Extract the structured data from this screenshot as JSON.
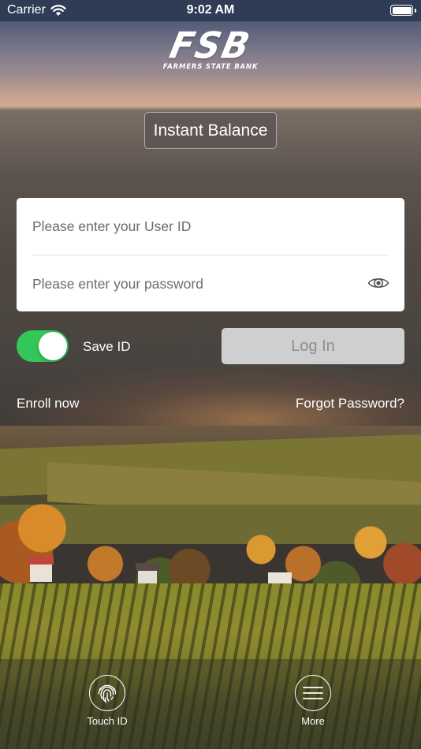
{
  "status_bar": {
    "carrier": "Carrier",
    "time": "9:02 AM",
    "wifi_icon": "wifi-icon",
    "battery_icon": "battery-icon"
  },
  "brand": {
    "logo_text": "FSB",
    "logo_subtext": "FARMERS STATE BANK"
  },
  "instant_balance": {
    "label": "Instant Balance"
  },
  "login_form": {
    "user_id_placeholder": "Please enter your User ID",
    "user_id_value": "",
    "password_placeholder": "Please enter your password",
    "password_value": "",
    "show_password_icon": "eye-icon",
    "save_id_label": "Save ID",
    "save_id_enabled": true,
    "login_label": "Log In",
    "login_enabled": false
  },
  "links": {
    "enroll": "Enroll now",
    "forgot_password": "Forgot Password?"
  },
  "tab_bar": {
    "items": [
      {
        "label": "Touch ID",
        "icon": "fingerprint-icon"
      },
      {
        "label": "More",
        "icon": "hamburger-menu-icon"
      }
    ]
  },
  "colors": {
    "toggle_on": "#33c659",
    "login_disabled_bg": "#cfcfcf",
    "login_disabled_text": "#8e8e8e",
    "status_bar_bg": "#2f3c55"
  }
}
